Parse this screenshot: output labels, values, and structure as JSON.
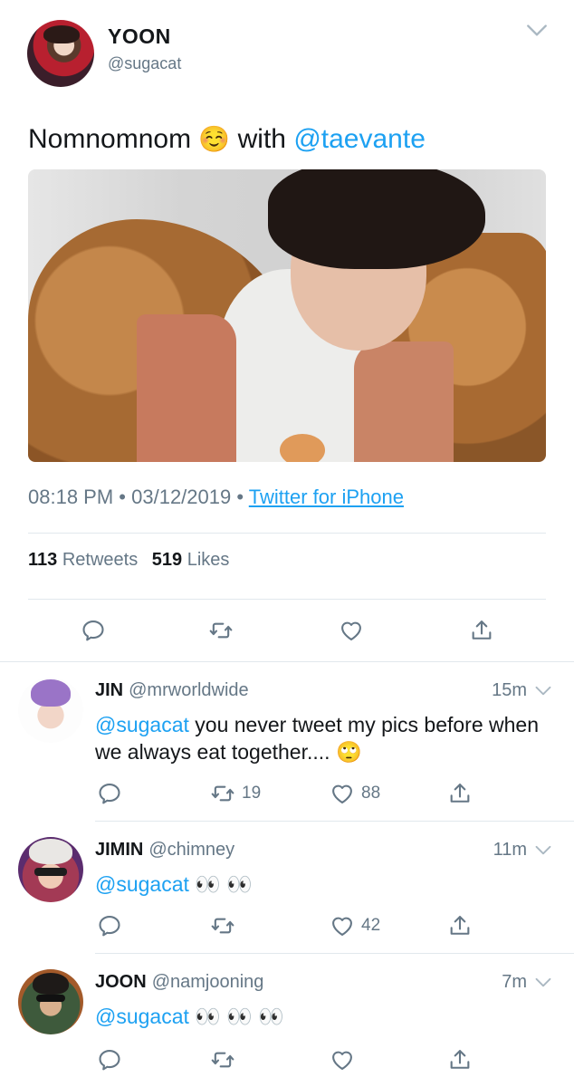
{
  "main_tweet": {
    "name": "YOON",
    "handle": "@sugacat",
    "text_before": "Nomnomnom",
    "text_emoji": "☺️",
    "text_with": "with",
    "mention": "@taevante",
    "time": "08:18 PM",
    "sep": "•",
    "date": "03/12/2019",
    "source": "Twitter for iPhone",
    "retweets_count": "113",
    "retweets_label": "Retweets",
    "likes_count": "519",
    "likes_label": "Likes"
  },
  "replies": [
    {
      "name": "JIN",
      "handle": "@mrworldwide",
      "time": "15m",
      "mention": "@sugacat",
      "text": "you never tweet my pics before when we always eat together....",
      "emoji": "🙄",
      "retweets": "19",
      "likes": "88"
    },
    {
      "name": "JIMIN",
      "handle": "@chimney",
      "time": "11m",
      "mention": "@sugacat",
      "emoji": "👀 👀",
      "retweets": "",
      "likes": "42"
    },
    {
      "name": "JOON",
      "handle": "@namjooning",
      "time": "7m",
      "mention": "@sugacat",
      "emoji": "👀 👀 👀",
      "retweets": "",
      "likes": ""
    }
  ],
  "icons": {
    "reply": "reply-icon",
    "retweet": "retweet-icon",
    "like": "heart-icon",
    "share": "share-icon",
    "caret": "chevron-down-icon"
  },
  "colors": {
    "link": "#1da1f2",
    "muted": "#657786",
    "text": "#14171a",
    "divider": "#e1e8ed"
  }
}
